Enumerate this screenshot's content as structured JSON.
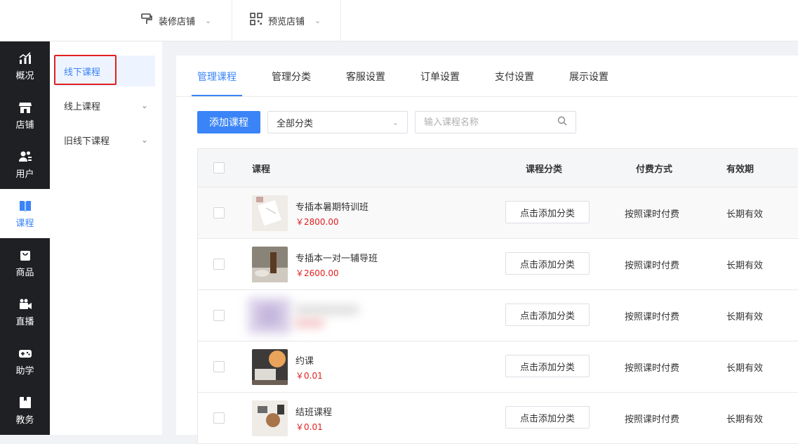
{
  "topbar": {
    "items": [
      {
        "label": "装修店铺",
        "icon": "paint-roller-icon"
      },
      {
        "label": "预览店铺",
        "icon": "qrcode-icon"
      }
    ]
  },
  "leftnav": {
    "items": [
      {
        "label": "概况",
        "icon": "chart-icon"
      },
      {
        "label": "店铺",
        "icon": "store-icon"
      },
      {
        "label": "用户",
        "icon": "users-icon"
      },
      {
        "label": "课程",
        "icon": "book-icon",
        "active": true
      },
      {
        "label": "商品",
        "icon": "bag-icon"
      },
      {
        "label": "直播",
        "icon": "camera-icon"
      },
      {
        "label": "助学",
        "icon": "gamepad-icon"
      },
      {
        "label": "教务",
        "icon": "folder-icon"
      }
    ]
  },
  "subnav": {
    "items": [
      {
        "label": "线下课程",
        "active": true
      },
      {
        "label": "线上课程"
      },
      {
        "label": "旧线下课程"
      }
    ]
  },
  "tabs": [
    "管理课程",
    "管理分类",
    "客服设置",
    "订单设置",
    "支付设置",
    "展示设置"
  ],
  "toolbar": {
    "add_label": "添加课程",
    "category_value": "全部分类",
    "search_placeholder": "输入课程名称"
  },
  "table": {
    "headers": {
      "course": "课程",
      "category": "课程分类",
      "payment": "付费方式",
      "validity": "有效期"
    },
    "rows": [
      {
        "name": "专插本暑期特训班",
        "price": "￥2800.00",
        "category_btn": "点击添加分类",
        "payment": "按照课时付费",
        "validity": "长期有效"
      },
      {
        "name": "专插本一对一辅导班",
        "price": "￥2600.00",
        "category_btn": "点击添加分类",
        "payment": "按照课时付费",
        "validity": "长期有效"
      },
      {
        "name": "",
        "price": "",
        "category_btn": "点击添加分类",
        "payment": "按照课时付费",
        "validity": "长期有效"
      },
      {
        "name": "约课",
        "price": "￥0.01",
        "category_btn": "点击添加分类",
        "payment": "按照课时付费",
        "validity": "长期有效"
      },
      {
        "name": "结班课程",
        "price": "￥0.01",
        "category_btn": "点击添加分类",
        "payment": "按照课时付费",
        "validity": "长期有效"
      }
    ]
  },
  "colors": {
    "accent": "#3a84f7",
    "price": "#e02020",
    "highlight": "#e02020",
    "nav_bg": "#1f2024"
  }
}
